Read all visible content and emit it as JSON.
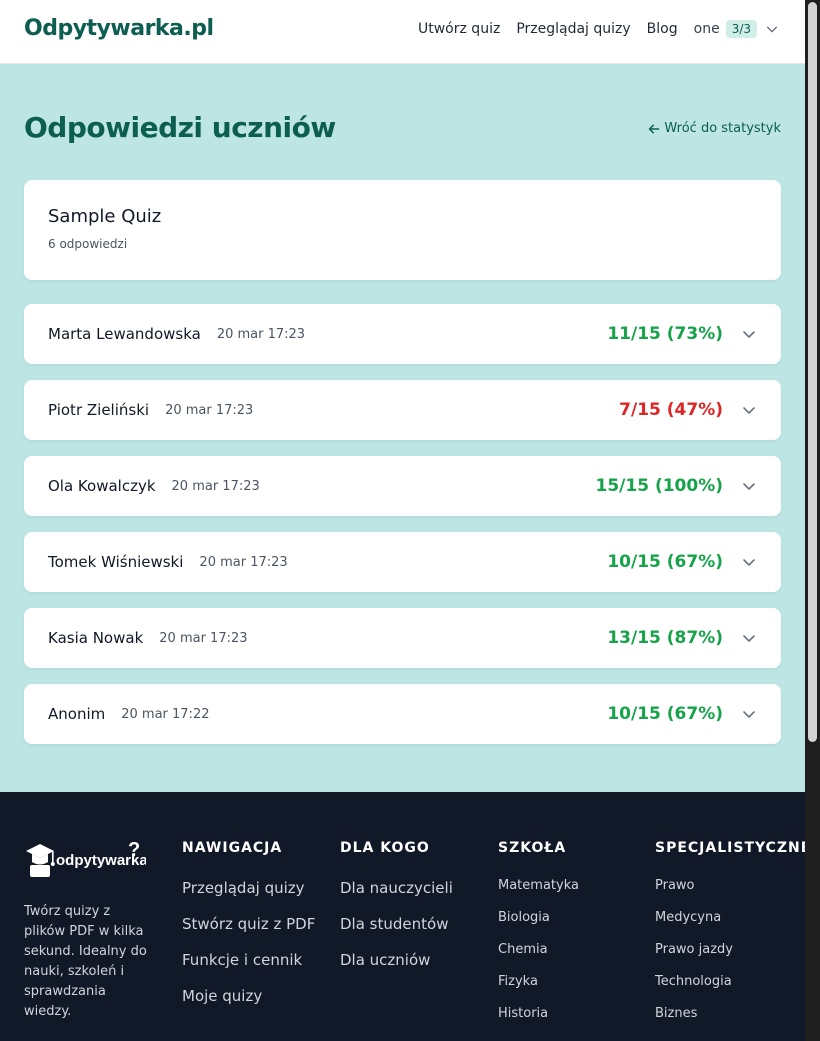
{
  "header": {
    "logo": "Odpytywarka.pl",
    "nav": [
      "Utwórz quiz",
      "Przeglądaj quizy",
      "Blog"
    ],
    "user_name": "one",
    "user_badge": "3/3"
  },
  "main": {
    "title": "Odpowiedzi uczniów",
    "back_link": "Wróć do statystyk",
    "quiz_name": "Sample Quiz",
    "quiz_count": "6 odpowiedzi",
    "responses": [
      {
        "name": "Marta Lewandowska",
        "date": "20 mar 17:23",
        "score": "11/15 (73%)",
        "status": "pass"
      },
      {
        "name": "Piotr Zieliński",
        "date": "20 mar 17:23",
        "score": "7/15 (47%)",
        "status": "fail"
      },
      {
        "name": "Ola Kowalczyk",
        "date": "20 mar 17:23",
        "score": "15/15 (100%)",
        "status": "pass"
      },
      {
        "name": "Tomek Wiśniewski",
        "date": "20 mar 17:23",
        "score": "10/15 (67%)",
        "status": "pass"
      },
      {
        "name": "Kasia Nowak",
        "date": "20 mar 17:23",
        "score": "13/15 (87%)",
        "status": "pass"
      },
      {
        "name": "Anonim",
        "date": "20 mar 17:22",
        "score": "10/15 (67%)",
        "status": "pass"
      }
    ]
  },
  "footer": {
    "logo_text": "odpytywarka.pl",
    "description": "Twórz quizy z plików PDF w kilka sekund. Idealny do nauki, szkoleń i sprawdzania wiedzy.",
    "columns": [
      {
        "heading": "NAWIGACJA",
        "links": [
          "Przeglądaj quizy",
          "Stwórz quiz z PDF",
          "Funkcje i cennik",
          "Moje quizy"
        ]
      },
      {
        "heading": "DLA KOGO",
        "links": [
          "Dla nauczycieli",
          "Dla studentów",
          "Dla uczniów"
        ]
      },
      {
        "heading": "SZKOŁA",
        "links": [
          "Matematyka",
          "Biologia",
          "Chemia",
          "Fizyka",
          "Historia"
        ]
      },
      {
        "heading": "SPECJALISTYCZNE",
        "links": [
          "Prawo",
          "Medycyna",
          "Prawo jazdy",
          "Technologia",
          "Biznes"
        ]
      }
    ]
  },
  "colors": {
    "brand": "#0b5e50",
    "pass": "#16a34a",
    "fail": "#dc2626",
    "main_bg": "#bce5e3",
    "footer_bg": "#111827"
  },
  "icons": {
    "user_menu": "chevron-down-icon",
    "back": "arrow-left-icon",
    "row_toggle": "chevron-down-icon",
    "footer_logo": "graduation-cap-icon"
  }
}
